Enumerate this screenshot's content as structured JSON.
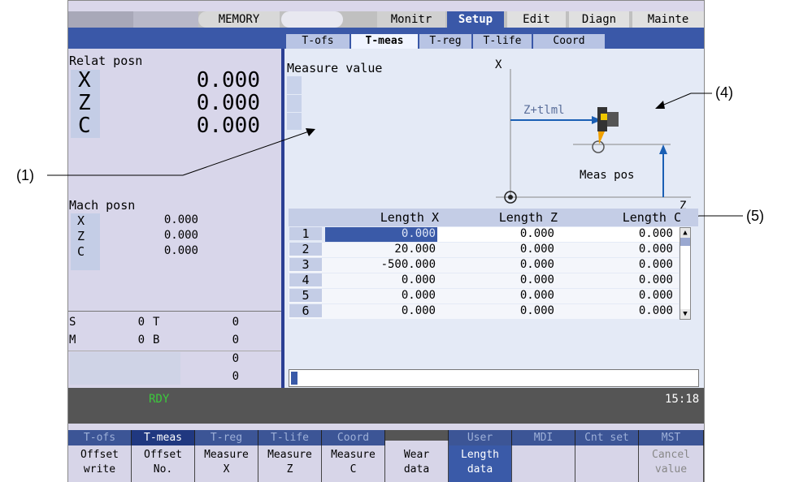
{
  "top_tabs": {
    "mode": "MEMORY",
    "monitr": "Monitr",
    "setup": "Setup",
    "edit": "Edit",
    "diagn": "Diagn",
    "mainte": "Mainte"
  },
  "sub_tabs": [
    "T-ofs",
    "T-meas",
    "T-reg",
    "T-life",
    "Coord"
  ],
  "relat": {
    "title": "Relat posn",
    "axes": [
      {
        "name": "X",
        "value": "0.000"
      },
      {
        "name": "Z",
        "value": "0.000"
      },
      {
        "name": "C",
        "value": "0.000"
      }
    ]
  },
  "mach": {
    "title": "Mach posn",
    "axes": [
      {
        "name": "X",
        "value": "0.000"
      },
      {
        "name": "Z",
        "value": "0.000"
      },
      {
        "name": "C",
        "value": "0.000"
      }
    ]
  },
  "spindle": {
    "s_label": "S",
    "s_val": "0",
    "t_label": "T",
    "t_val": "0",
    "m_label": "M",
    "m_val": "0",
    "b_label": "B",
    "b_val": "0",
    "extra1": "0",
    "extra2": "0"
  },
  "measure": {
    "title": "Measure value",
    "axis_x": "X",
    "axis_z": "Z",
    "formula": "Z+tlml",
    "meas_pos": "Meas pos"
  },
  "table": {
    "headers": [
      "Length X",
      "Length Z",
      "Length C"
    ],
    "rows": [
      {
        "n": "1",
        "x": "0.000",
        "z": "0.000",
        "c": "0.000"
      },
      {
        "n": "2",
        "x": "20.000",
        "z": "0.000",
        "c": "0.000"
      },
      {
        "n": "3",
        "x": "-500.000",
        "z": "0.000",
        "c": "0.000"
      },
      {
        "n": "4",
        "x": "0.000",
        "z": "0.000",
        "c": "0.000"
      },
      {
        "n": "5",
        "x": "0.000",
        "z": "0.000",
        "c": "0.000"
      },
      {
        "n": "6",
        "x": "0.000",
        "z": "0.000",
        "c": "0.000"
      }
    ]
  },
  "status": {
    "rdy": "RDY",
    "time": "15:18"
  },
  "menu_tabs": [
    "T-ofs",
    "T-meas",
    "T-reg",
    "T-life",
    "Coord",
    "",
    "User",
    "MDI",
    "Cnt set",
    "MST"
  ],
  "menu_buttons": [
    {
      "l1": "Offset",
      "l2": "write"
    },
    {
      "l1": "Offset",
      "l2": "No."
    },
    {
      "l1": "Measure",
      "l2": "X"
    },
    {
      "l1": "Measure",
      "l2": "Z"
    },
    {
      "l1": "Measure",
      "l2": "C"
    },
    {
      "l1": "Wear",
      "l2": "data"
    },
    {
      "l1": "Length",
      "l2": "data"
    },
    {
      "l1": "",
      "l2": ""
    },
    {
      "l1": "",
      "l2": ""
    },
    {
      "l1": "Cancel",
      "l2": "value"
    }
  ],
  "callouts": {
    "c1": "(1)",
    "c4": "(4)",
    "c5": "(5)"
  },
  "colors": {
    "blue_band": "#3a58a8",
    "panel": "#d8d6ea",
    "highlight": "#3a5aa8",
    "arrow": "#1a5fb4"
  }
}
